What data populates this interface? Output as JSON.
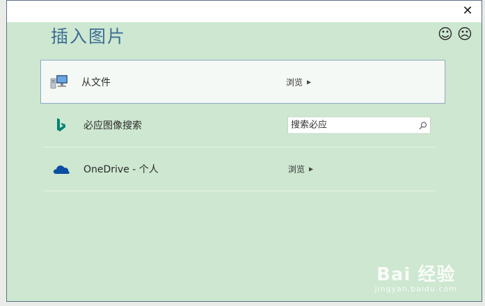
{
  "dialog": {
    "title": "插入图片",
    "close_glyph": "✕",
    "feedback": {
      "smile_icon": "☺",
      "frown_icon": "☹"
    }
  },
  "rows": [
    {
      "label": "从文件",
      "action": "browse",
      "browse_label": "浏览",
      "icon": "computer-icon"
    },
    {
      "label": "必应图像搜索",
      "action": "search",
      "search_placeholder": "搜索必应",
      "icon": "bing-icon"
    },
    {
      "label": "OneDrive - 个人",
      "action": "browse",
      "browse_label": "浏览",
      "icon": "onedrive-cloud-icon"
    }
  ],
  "watermark": {
    "text": "Bai 经验",
    "sub": "jingyan.baidu.com"
  },
  "colors": {
    "dialog_bg": "#cde7d0",
    "title": "#3e6e97",
    "selected_border": "#8ea7c3",
    "bing": "#008373",
    "onedrive": "#0a4da2"
  }
}
